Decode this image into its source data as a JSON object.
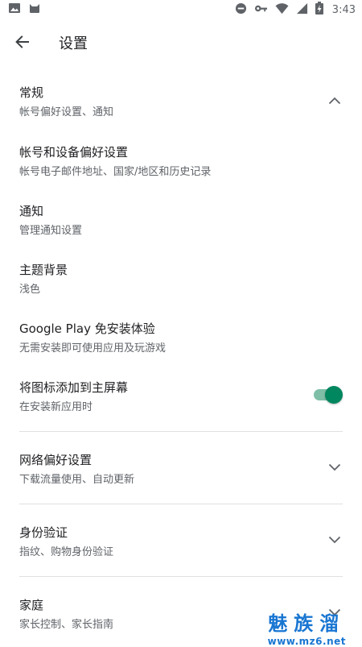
{
  "status_bar": {
    "time": "3:43",
    "left_icons": [
      "image-icon",
      "android-cat-icon"
    ],
    "right_icons": [
      "do-not-disturb-icon",
      "key-icon",
      "wifi-icon",
      "signal-icon",
      "battery-charging-icon"
    ]
  },
  "app_bar": {
    "title": "设置"
  },
  "sections": {
    "general": {
      "title": "常规",
      "subtitle": "帐号偏好设置、通知"
    },
    "account": {
      "title": "帐号和设备偏好设置",
      "subtitle": "帐号电子邮件地址、国家/地区和历史记录"
    },
    "notifications": {
      "title": "通知",
      "subtitle": "管理通知设置"
    },
    "theme": {
      "title": "主题背景",
      "subtitle": "浅色"
    },
    "instant": {
      "title": "Google Play 免安装体验",
      "subtitle": "无需安装即可使用应用及玩游戏"
    },
    "home_icon": {
      "title": "将图标添加到主屏幕",
      "subtitle": "在安装新应用时",
      "enabled": true
    },
    "network": {
      "title": "网络偏好设置",
      "subtitle": "下载流量使用、自动更新"
    },
    "auth": {
      "title": "身份验证",
      "subtitle": "指纹、购物身份验证"
    },
    "family": {
      "title": "家庭",
      "subtitle": "家长控制、家长指南"
    }
  },
  "watermark": {
    "main": "魅族溜",
    "url": "www.mz6.net"
  },
  "colors": {
    "accent": "#01875f",
    "accent_track": "#7fbfa8",
    "watermark": "#1976d2"
  }
}
